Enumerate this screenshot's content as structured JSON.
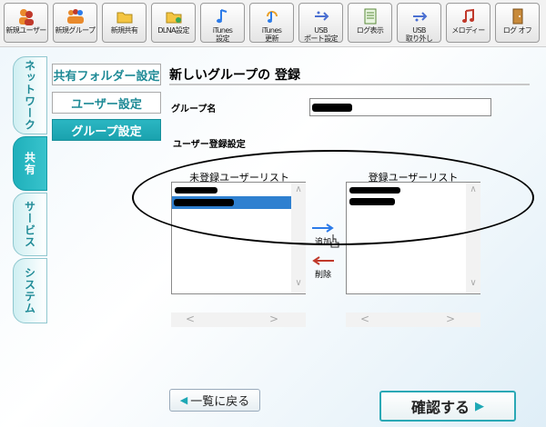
{
  "toolbar": {
    "buttons": [
      {
        "label": "新規ユーザー",
        "icon": "users-icon"
      },
      {
        "label": "新規グループ",
        "icon": "group-icon"
      },
      {
        "label": "新規共有",
        "icon": "folder-icon"
      },
      {
        "label": "DLNA設定",
        "icon": "dlna-folder-icon"
      },
      {
        "label": "iTunes",
        "label2": "設定",
        "icon": "music-note-icon"
      },
      {
        "label": "iTunes",
        "label2": "更新",
        "icon": "music-refresh-icon"
      },
      {
        "label": "USB",
        "label2": "ポート設定",
        "icon": "usb-icon"
      },
      {
        "label": "ログ表示",
        "icon": "log-icon"
      },
      {
        "label": "USB",
        "label2": "取り外し",
        "icon": "usb-remove-icon"
      },
      {
        "label": "メロディー",
        "icon": "melody-icon"
      },
      {
        "label": "ログ オフ",
        "icon": "logoff-icon"
      }
    ]
  },
  "side_tabs": [
    {
      "label": "ネットワーク",
      "active": false
    },
    {
      "label": "共有",
      "active": true
    },
    {
      "label": "サービス",
      "active": false
    },
    {
      "label": "システム",
      "active": false
    }
  ],
  "submenu": {
    "shared_folder": "共有フォルダー設定",
    "user": "ユーザー設定",
    "group": "グループ設定"
  },
  "main": {
    "title": "新しいグループの 登録",
    "group_name_label": "グループ名",
    "user_reg_label": "ユーザー登録設定",
    "unregistered_title": "未登録ユーザーリスト",
    "registered_title": "登録ユーザーリスト",
    "add_label": "追加",
    "delete_label": "削除",
    "back_label": "一覧に戻る",
    "confirm_label": "確認する"
  },
  "colors": {
    "accent": "#1ea8b5",
    "selection": "#2f80d0"
  }
}
